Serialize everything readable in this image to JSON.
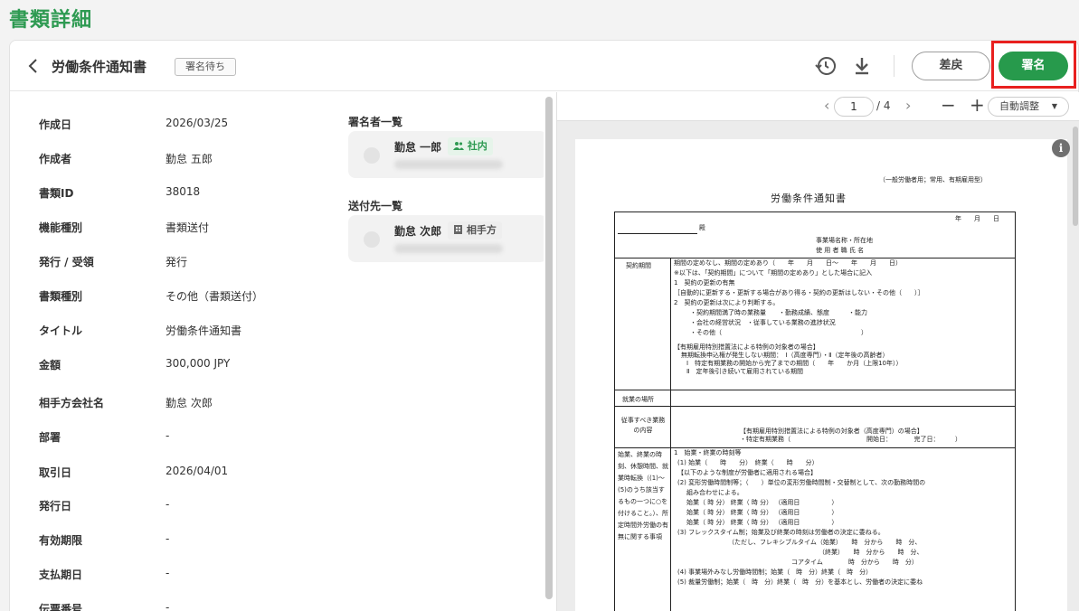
{
  "page": {
    "title": "書類詳細"
  },
  "header": {
    "back_icon": "chevron-left-icon",
    "doc_title": "労働条件通知書",
    "status": "署名待ち",
    "history_icon": "history-icon",
    "download_icon": "download-icon",
    "reject_label": "差戻",
    "sign_label": "署名",
    "brand_color": "#279a4c",
    "highlight_color": "#e8201f"
  },
  "details": [
    {
      "label": "作成日",
      "value": "2026/03/25"
    },
    {
      "label": "作成者",
      "value": "勤怠 五郎"
    },
    {
      "label": "書類ID",
      "value": "38018"
    },
    {
      "label": "機能種別",
      "value": "書類送付"
    },
    {
      "label": "発行 / 受領",
      "value": "発行"
    },
    {
      "label": "書類種別",
      "value": "その他（書類送付）"
    },
    {
      "label": "タイトル",
      "value": "労働条件通知書"
    },
    {
      "label": "金額",
      "value": "300,000 JPY"
    },
    {
      "label": "相手方会社名",
      "value": "勤怠 次郎"
    },
    {
      "label": "部署",
      "value": "-"
    },
    {
      "label": "取引日",
      "value": "2026/04/01"
    },
    {
      "label": "発行日",
      "value": "-"
    },
    {
      "label": "有効期限",
      "value": "-"
    },
    {
      "label": "支払期日",
      "value": "-"
    },
    {
      "label": "伝票番号",
      "value": "-"
    }
  ],
  "signers": {
    "title": "署名者一覧",
    "items": [
      {
        "name": "勤怠 一郎",
        "tag": "社内",
        "tag_icon": "people-icon"
      }
    ]
  },
  "recipients": {
    "title": "送付先一覧",
    "items": [
      {
        "name": "勤怠 次郎",
        "tag": "相手方",
        "tag_icon": "building-icon"
      }
    ]
  },
  "viewer": {
    "current_page": "1",
    "total": "/ 4",
    "zoom_label": "自動調整",
    "document": {
      "type_note": "（一般労働者用；常用、有期雇用型）",
      "heading": "労働条件通知書",
      "date_row": "年　　月　　日",
      "to": "殿",
      "company_addr": "事業場名称・所在地",
      "employer": "使 用 者 職 氏 名",
      "rows": [
        {
          "label": "契約期間",
          "lines": [
            "期間の定めなし、期間の定めあり（　　年　　月　　日～　　年　　月　　日）",
            "※以下は、「契約期間」について「期間の定めあり」とした場合に記入",
            "1　契約の更新の有無",
            "［自動的に更新する・更新する場合があり得る・契約の更新はしない・その他（　　）］",
            "2　契約の更新は次により判断する。",
            "・契約期間満了時の業務量　　・勤務成績、態度　　　・能力",
            "・会社の経営状況　・従事している業務の進捗状況",
            "・その他（　　　　　　　　　　　　　　　　　　　　　　）",
            "【有期雇用特別措置法による特例の対象者の場合】",
            "無期転換申込権が発生しない期間：　Ⅰ（高度専門）・Ⅱ（定年後の高齢者）",
            "Ⅰ　特定有期業務の開始から完了までの期間（　　年　　か月（上限10年））",
            "Ⅱ　定年後引き続いて雇用されている期間"
          ]
        },
        {
          "label": "就業の場所",
          "lines": []
        },
        {
          "label": "従事すべき業務の内容",
          "lines": [
            "【有期雇用特別措置法による特例の対象者（高度専門）の場合】",
            "・特定有期業務（　　　　　　　　　　　　開始日：　　　　完了日：　　　）"
          ]
        },
        {
          "label": "始業、終業の時刻、休憩時間、就業時転換（(1)～(5)のうち該当するもの一つに○を付けること。）、所定時間外労働の有無に関する事項",
          "lines": [
            "1　始業・終業の時刻等",
            "(1) 始業（　　時　　分）　終業（　　時　　分）",
            "【以下のような制度が労働者に適用される場合】",
            "(2) 変形労働時間制等；（　　）単位の変形労働時間制・交替制として、次の勤務時間の",
            "組み合わせによる。",
            "始業（ 時 分） 終業（ 時 分） （適用日　　　　　）",
            "始業（ 時 分） 終業（ 時 分） （適用日　　　　　）",
            "始業（ 時 分） 終業（ 時 分） （適用日　　　　　）",
            "(3) フレックスタイム制；始業及び終業の時刻は労働者の決定に委ねる。",
            "（ただし、フレキシブルタイム（始業）　　時　分から　　時　分、",
            "（終業）　　時　分から　　時　分、",
            "コアタイム　　　　時　分から　　時　分）",
            "(4) 事業場外みなし労働時間制；始業（　時　分）終業（　時　分）",
            "(5) 裁量労働制；始業（　時　分）終業（　時　分）を基本とし、労働者の決定に委ね"
          ]
        }
      ]
    }
  }
}
